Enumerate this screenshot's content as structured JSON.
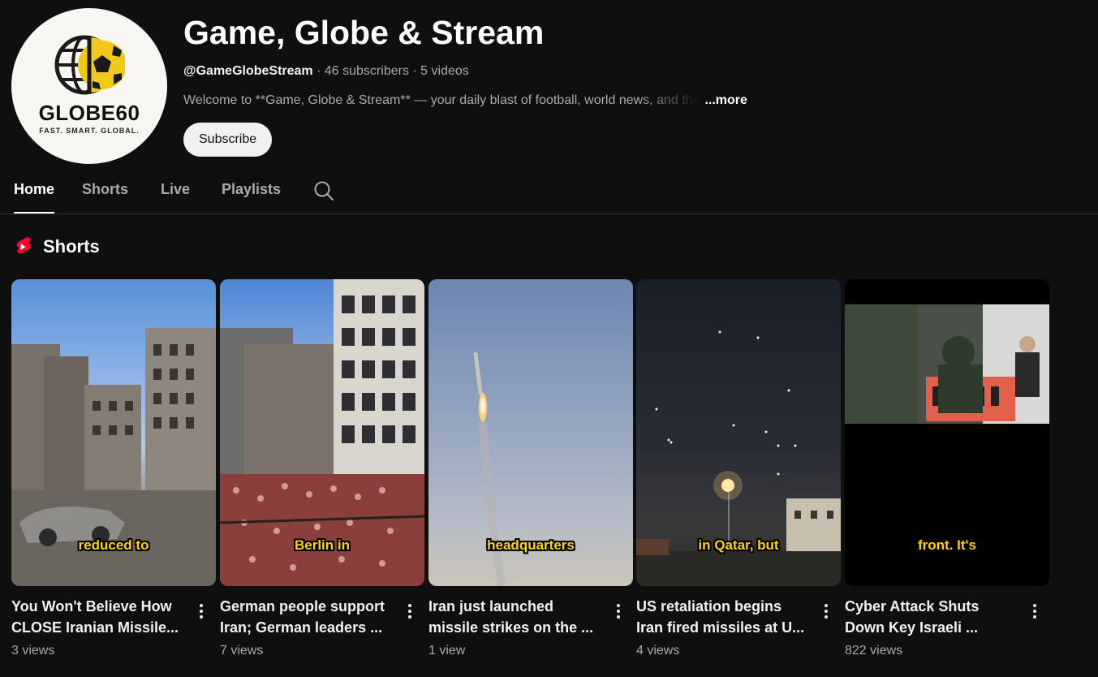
{
  "channel": {
    "logo_text": "GLOBE60",
    "logo_tagline": "FAST. SMART. GLOBAL.",
    "title": "Game, Globe & Stream",
    "handle": "@GameGlobeStream",
    "subscribers": "46 subscribers",
    "videos": "5 videos",
    "separator": "·",
    "description": "Welcome to **Game, Globe & Stream** — your daily blast of football, world news, and the",
    "more_label": "...more",
    "subscribe_label": "Subscribe"
  },
  "tabs": [
    {
      "label": "Home",
      "active": true
    },
    {
      "label": "Shorts",
      "active": false
    },
    {
      "label": "Live",
      "active": false
    },
    {
      "label": "Playlists",
      "active": false
    }
  ],
  "section": {
    "title": "Shorts",
    "icon": "shorts-icon"
  },
  "shorts": [
    {
      "caption": "reduced to",
      "title_line1": "You Won't Believe How",
      "title_line2": "CLOSE Iranian Missile...",
      "views": "3 views"
    },
    {
      "caption": "Berlin in",
      "title_line1": "German people support",
      "title_line2": "Iran; German leaders ...",
      "views": "7 views"
    },
    {
      "caption": "headquarters",
      "title_line1": "Iran just launched",
      "title_line2": "missile strikes on the ...",
      "views": "1 view"
    },
    {
      "caption": "in Qatar, but",
      "title_line1": "US retaliation begins",
      "title_line2": "Iran fired missiles at U...",
      "views": "4 views"
    },
    {
      "caption": "front. It's",
      "title_line1": "Cyber Attack Shuts",
      "title_line2": "Down Key Israeli ...",
      "views": "822 views"
    }
  ],
  "colors": {
    "background": "#0f0f0f",
    "caption_yellow": "#ffd400",
    "shorts_red": "#ff0033"
  }
}
